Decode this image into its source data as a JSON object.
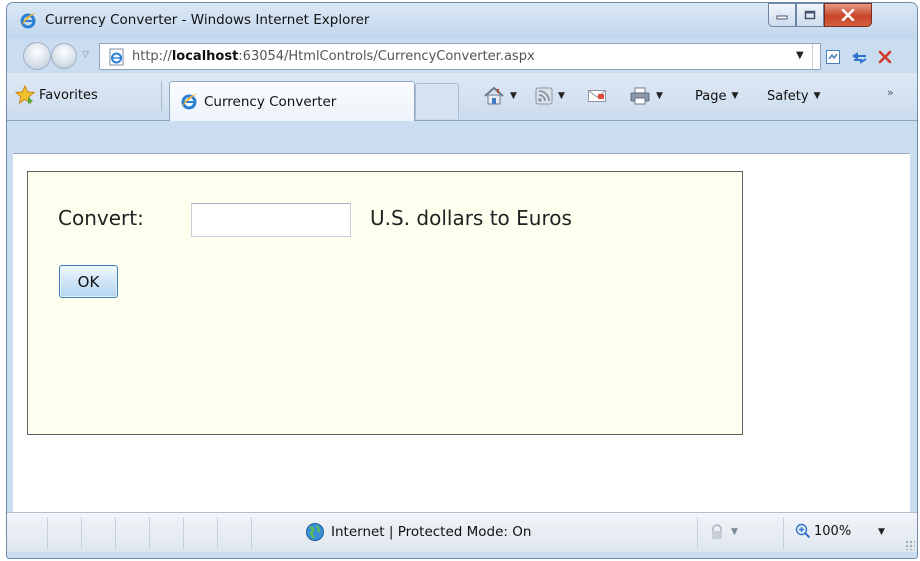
{
  "window": {
    "title": "Currency Converter - Windows Internet Explorer"
  },
  "address_bar": {
    "url_prefix": "http://",
    "url_host": "localhost",
    "url_rest": ":63054/HtmlControls/CurrencyConverter.aspx"
  },
  "command_bar": {
    "favorites_label": "Favorites",
    "tab_label": "Currency Converter",
    "page_label": "Page",
    "safety_label": "Safety",
    "more_label": "»"
  },
  "form": {
    "convert_label": "Convert:",
    "amount_value": "",
    "suffix_label": "U.S. dollars to Euros",
    "ok_label": "OK"
  },
  "status_bar": {
    "zone_text": "Internet | Protected Mode: On",
    "zoom_text": "100%"
  },
  "colors": {
    "panel_background": "#fffff0",
    "title_bar": "#c9dcf0",
    "close_button": "#c9452a"
  }
}
